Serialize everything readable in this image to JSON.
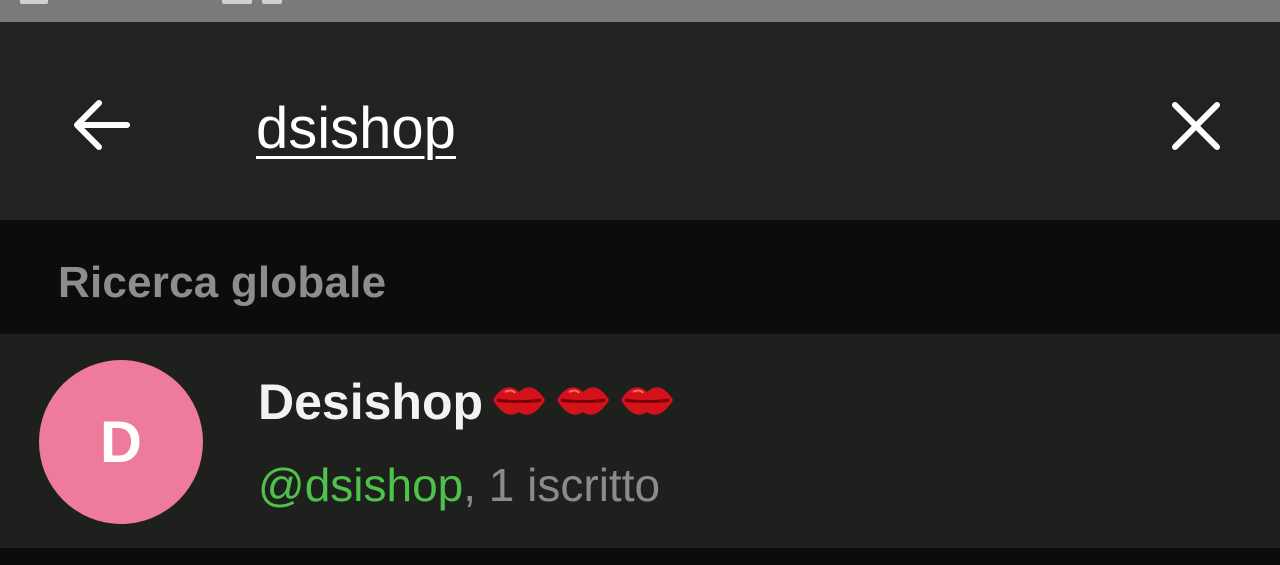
{
  "search": {
    "query": "dsishop"
  },
  "section": {
    "title": "Ricerca globale"
  },
  "results": [
    {
      "avatar_letter": "D",
      "avatar_color": "#ee7a9c",
      "name": "Desishop",
      "name_emoji": [
        "kiss-mark",
        "kiss-mark",
        "kiss-mark"
      ],
      "username": "@dsishop",
      "subscribers": ", 1 iscritto"
    }
  ],
  "colors": {
    "toolbar_bg": "#212321",
    "header_bg": "#0b0d0b",
    "row_bg": "#1e201e",
    "username_green": "#4fc24a",
    "muted_text": "#8a8c8a"
  },
  "icons": {
    "back": "arrow-left-icon",
    "clear": "close-icon",
    "emoji": "kiss-mark-icon"
  }
}
